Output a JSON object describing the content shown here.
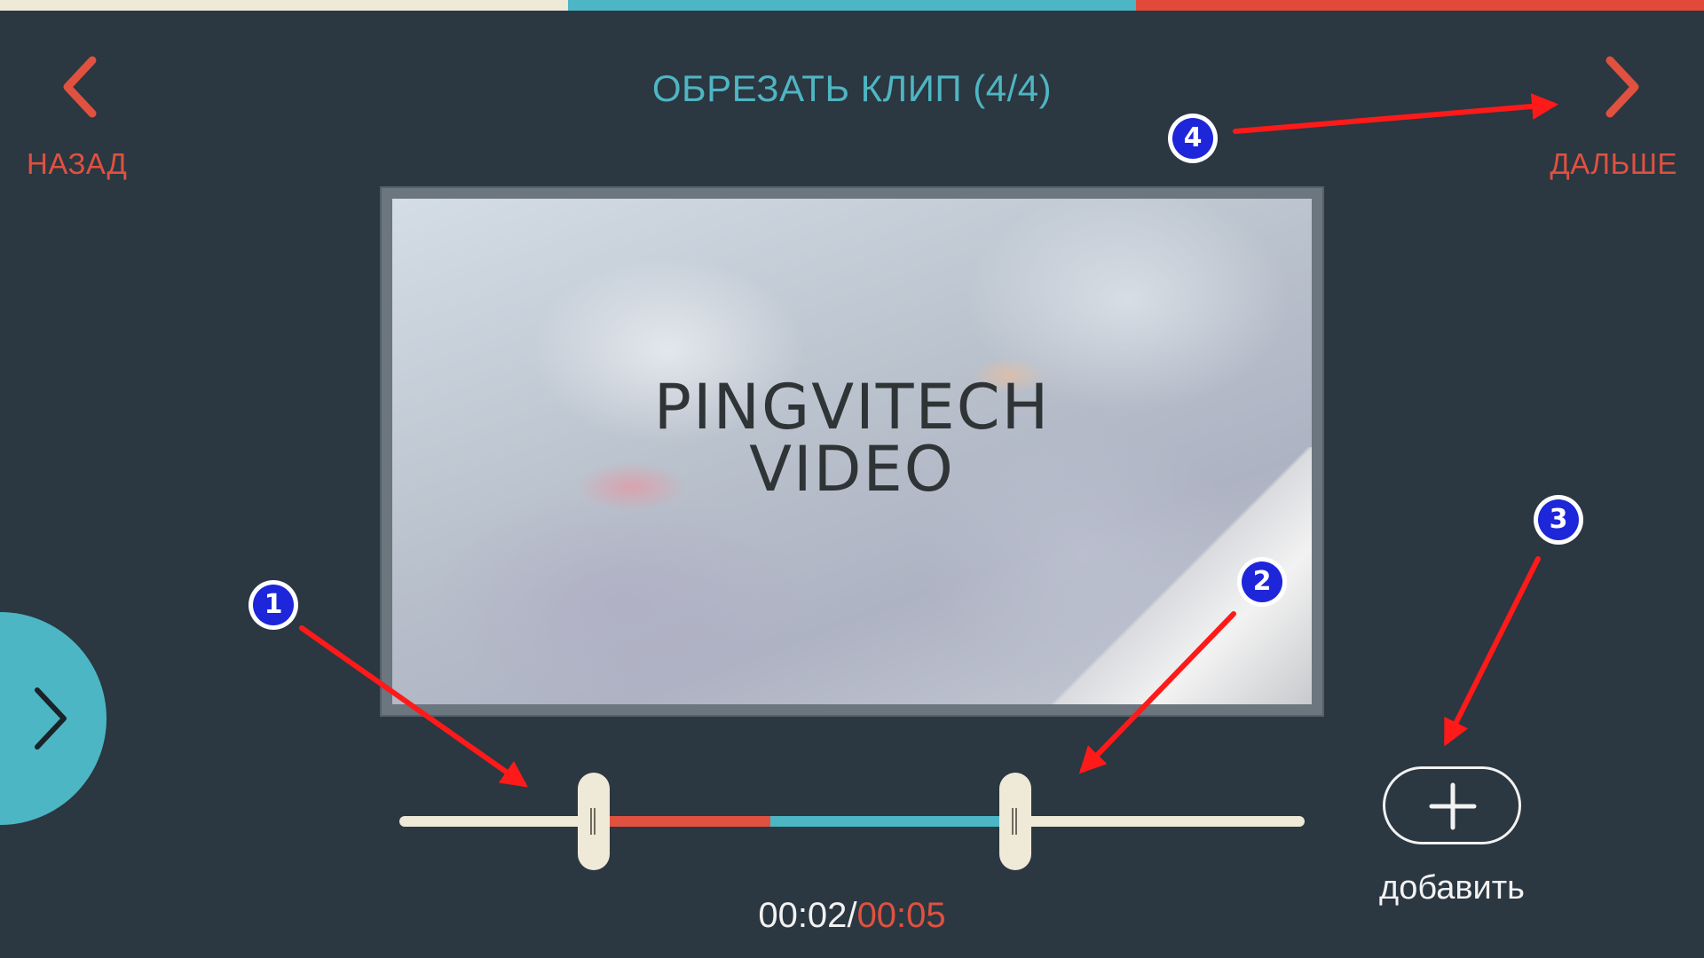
{
  "header": {
    "title": "ОБРЕЗАТЬ КЛИП (4/4)",
    "back_label": "НАЗАД",
    "next_label": "ДАЛЬШЕ"
  },
  "preview": {
    "logo_line1": "PINGVITECH",
    "logo_line2": "VIDEO"
  },
  "timeline": {
    "current_time": "00:02",
    "separator": "/",
    "total_time": "00:05",
    "trim_start_fraction": 0.215,
    "trim_end_fraction": 0.68,
    "playhead_fraction": 0.41
  },
  "add_button": {
    "label": "добавить"
  },
  "annotations": {
    "markers": [
      "1",
      "2",
      "3",
      "4"
    ]
  },
  "colors": {
    "background": "#2b3741",
    "accent_red": "#e0513f",
    "accent_blue": "#4cb6c4",
    "cream": "#efe9d8",
    "marker_blue": "#1d26d8",
    "arrow_red": "#ff1a1a"
  },
  "icons": {
    "back": "chevron-left-icon",
    "next": "chevron-right-icon",
    "expander": "chevron-right-icon",
    "add": "plus-icon"
  }
}
